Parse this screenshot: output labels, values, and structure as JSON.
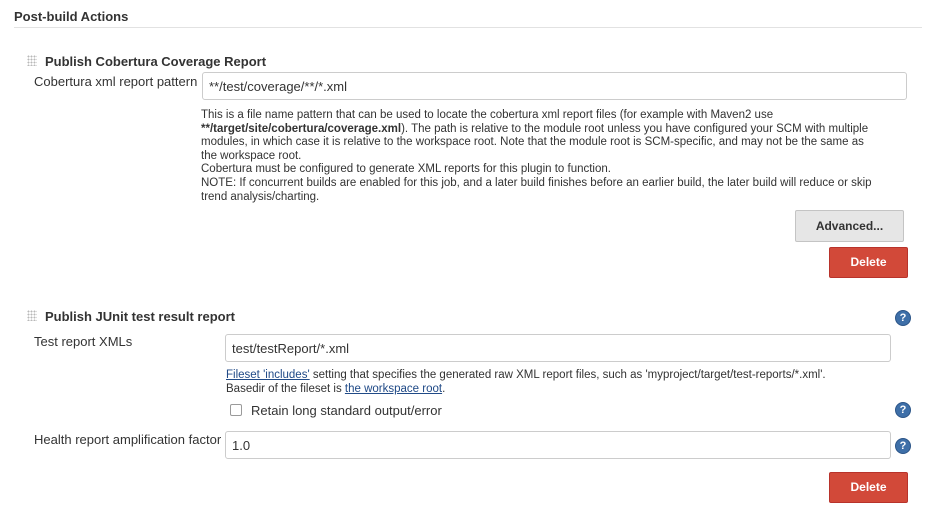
{
  "section": {
    "title": "Post-build Actions"
  },
  "cobertura": {
    "title": "Publish Cobertura Coverage Report",
    "pattern_label": "Cobertura xml report pattern",
    "pattern_value": "**/test/coverage/**/*.xml",
    "help": {
      "l1": "This is a file name pattern that can be used to locate the cobertura xml report files (for example with Maven2 use",
      "l2_bold": "**/target/site/cobertura/coverage.xml",
      "l2_rest": "). The path is relative to the module root unless you have configured your SCM with multiple",
      "l3": "modules, in which case it is relative to the workspace root. Note that the module root is SCM-specific, and may not be the same as",
      "l4": "the workspace root.",
      "l5": "Cobertura must be configured to generate XML reports for this plugin to function.",
      "l6": "NOTE: If concurrent builds are enabled for this job, and a later build finishes before an earlier build, the later build will reduce or skip",
      "l7": "trend analysis/charting."
    },
    "advanced_label": "Advanced...",
    "delete_label": "Delete"
  },
  "junit": {
    "title": "Publish JUnit test result report",
    "xml_label": "Test report XMLs",
    "xml_value": "test/testReport/*.xml",
    "help": {
      "link1": "Fileset 'includes'",
      "l1_rest": " setting that specifies the generated raw XML report files, such as 'myproject/target/test-reports/*.xml'.",
      "l2_prefix": "Basedir of the fileset is ",
      "link2": "the workspace root",
      "l2_suffix": "."
    },
    "retain_label": "Retain long standard output/error",
    "retain_checked": false,
    "health_label": "Health report amplification factor",
    "health_value": "1.0",
    "delete_label": "Delete"
  },
  "icons": {
    "help": "?"
  },
  "colors": {
    "delete": "#d24939",
    "help_icon": "#3e6fa8",
    "link": "#204a87"
  }
}
